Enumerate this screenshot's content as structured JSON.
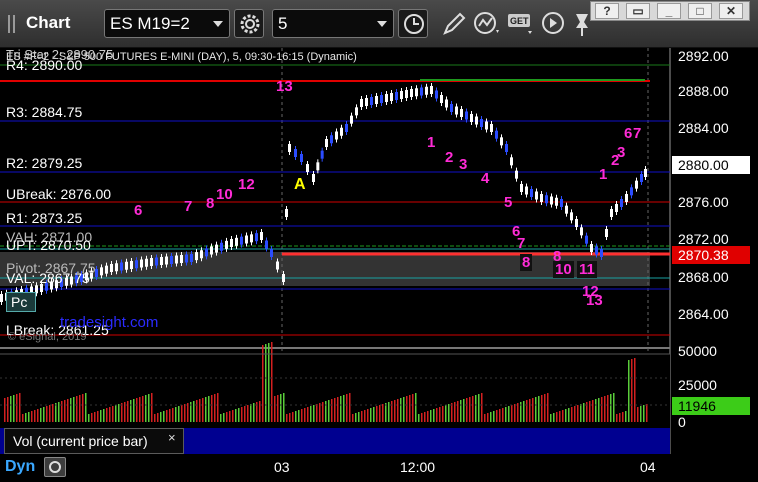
{
  "toolbar": {
    "title": "Chart",
    "symbol": "ES M19=2",
    "interval": "5"
  },
  "window_buttons": [
    "?",
    "▭",
    "_",
    "□",
    "✕"
  ],
  "chart": {
    "header": "ES #F=2 - S&P 500 FUTURES E-MINI (DAY), 5, 09:30-16:15 (Dynamic)",
    "header_overlay": "Tri Star 2: 2890.75",
    "levels": {
      "r4": "R4: 2890.00",
      "r3": "R3: 2884.75",
      "r2": "R2: 2879.25",
      "ubreak": "UBreak: 2876.00",
      "r1": "R1: 2873.25",
      "vah": "VAH: 2871.00",
      "upt": "UPT: 2870.50",
      "pivot": "Pivot: 2867.75",
      "val": "VAL: 2867.75",
      "lbreak": "LBreak: 2861.25"
    },
    "price_axis": [
      "2892.00",
      "2888.00",
      "2884.00",
      "2880.00",
      "2876.00",
      "2872.00",
      "2868.00",
      "2864.00"
    ],
    "last_price": "2880.00",
    "marker_price": "2870.38",
    "marker_a": "A",
    "watermarks": [
      "tradesight.com",
      "© eSignal, 2019"
    ],
    "counts": [
      "13",
      "6",
      "7",
      "8",
      "10",
      "12",
      "1",
      "2",
      "3",
      "4",
      "5",
      "6",
      "7",
      "8",
      "8",
      "10",
      "11",
      "12",
      "13",
      "1",
      "2",
      "3",
      "6",
      "7"
    ],
    "pc_label": "Pc"
  },
  "volume": {
    "axis": [
      "50000",
      "25000",
      "0"
    ],
    "current": "11946"
  },
  "study_tab": {
    "label": "Vol (current price bar)",
    "close": "×"
  },
  "time_axis": {
    "mode": "Dyn",
    "labels": [
      "03",
      "12:00",
      "04"
    ]
  },
  "colors": {
    "magenta": "#ff2bd6",
    "green_count": "#1fa31f",
    "resistance": "#d00000",
    "pivot_blue": "#1111cc",
    "panel_blue": "#000090"
  }
}
